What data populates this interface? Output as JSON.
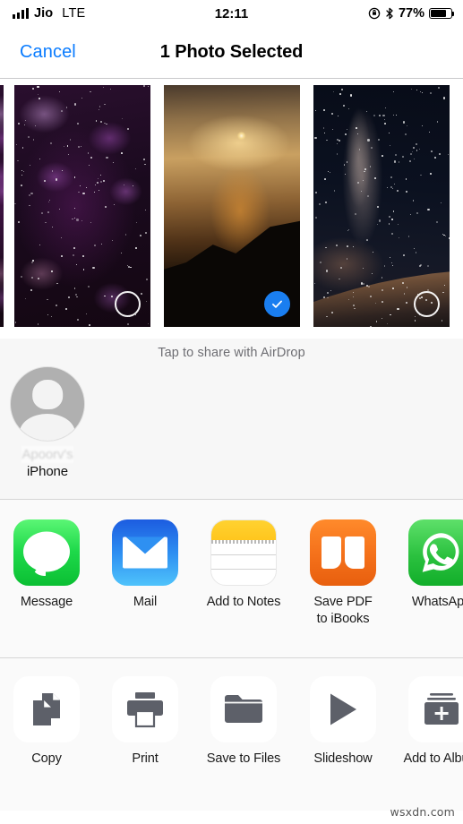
{
  "status_bar": {
    "carrier": "Jio",
    "network": "LTE",
    "time": "12:11",
    "battery_percent": "77%",
    "battery_level": 77,
    "icons": [
      "signal-bars-icon",
      "rotation-lock-icon",
      "bluetooth-icon",
      "battery-icon"
    ]
  },
  "navbar": {
    "cancel_label": "Cancel",
    "title": "1 Photo Selected"
  },
  "photos": {
    "items": [
      {
        "name": "purple-nebula",
        "selected": false
      },
      {
        "name": "sunset-over-sea",
        "selected": true
      },
      {
        "name": "milky-way-mountains",
        "selected": false
      }
    ],
    "selected_count": 1
  },
  "airdrop": {
    "hint": "Tap to share with AirDrop",
    "contacts": [
      {
        "name_line1": "Apoorv's",
        "name_line2": "iPhone",
        "redacted_line1": true,
        "avatar": "person-placeholder-icon"
      }
    ]
  },
  "apps": {
    "items": [
      {
        "label": "Message",
        "icon": "messages-app-icon"
      },
      {
        "label": "Mail",
        "icon": "mail-app-icon"
      },
      {
        "label": "Add to Notes",
        "icon": "notes-app-icon"
      },
      {
        "label": "Save PDF\nto iBooks",
        "icon": "ibooks-app-icon"
      },
      {
        "label": "WhatsApp",
        "icon": "whatsapp-app-icon"
      }
    ]
  },
  "actions": {
    "items": [
      {
        "label": "Copy",
        "icon": "copy-icon"
      },
      {
        "label": "Print",
        "icon": "printer-icon"
      },
      {
        "label": "Save to Files",
        "icon": "folder-icon"
      },
      {
        "label": "Slideshow",
        "icon": "play-icon"
      },
      {
        "label": "Add to Album",
        "icon": "add-to-album-icon"
      }
    ]
  },
  "watermark": "wsxdn.com",
  "colors": {
    "accent_blue": "#0a7cff",
    "selected_blue": "#1a7ef0",
    "messages_green": "#1ED94A",
    "mail_blue": "#2E90F2",
    "notes_yellow": "#FFC61E",
    "ibooks_orange": "#F4701A",
    "whatsapp_green": "#2BC13F",
    "action_gray": "#5d6069",
    "sheet_bg": "#fafafa",
    "airdrop_bg": "#f7f7f7"
  }
}
